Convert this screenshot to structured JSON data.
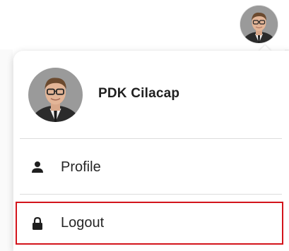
{
  "user": {
    "name": "PDK Cilacap",
    "avatar_icon": "user-avatar-photo"
  },
  "menu": {
    "items": [
      {
        "label": "Profile",
        "icon": "person-icon"
      },
      {
        "label": "Logout",
        "icon": "lock-icon"
      }
    ]
  },
  "colors": {
    "highlight_border": "#d3141c",
    "text": "#262626",
    "divider": "#dcdcdc"
  }
}
